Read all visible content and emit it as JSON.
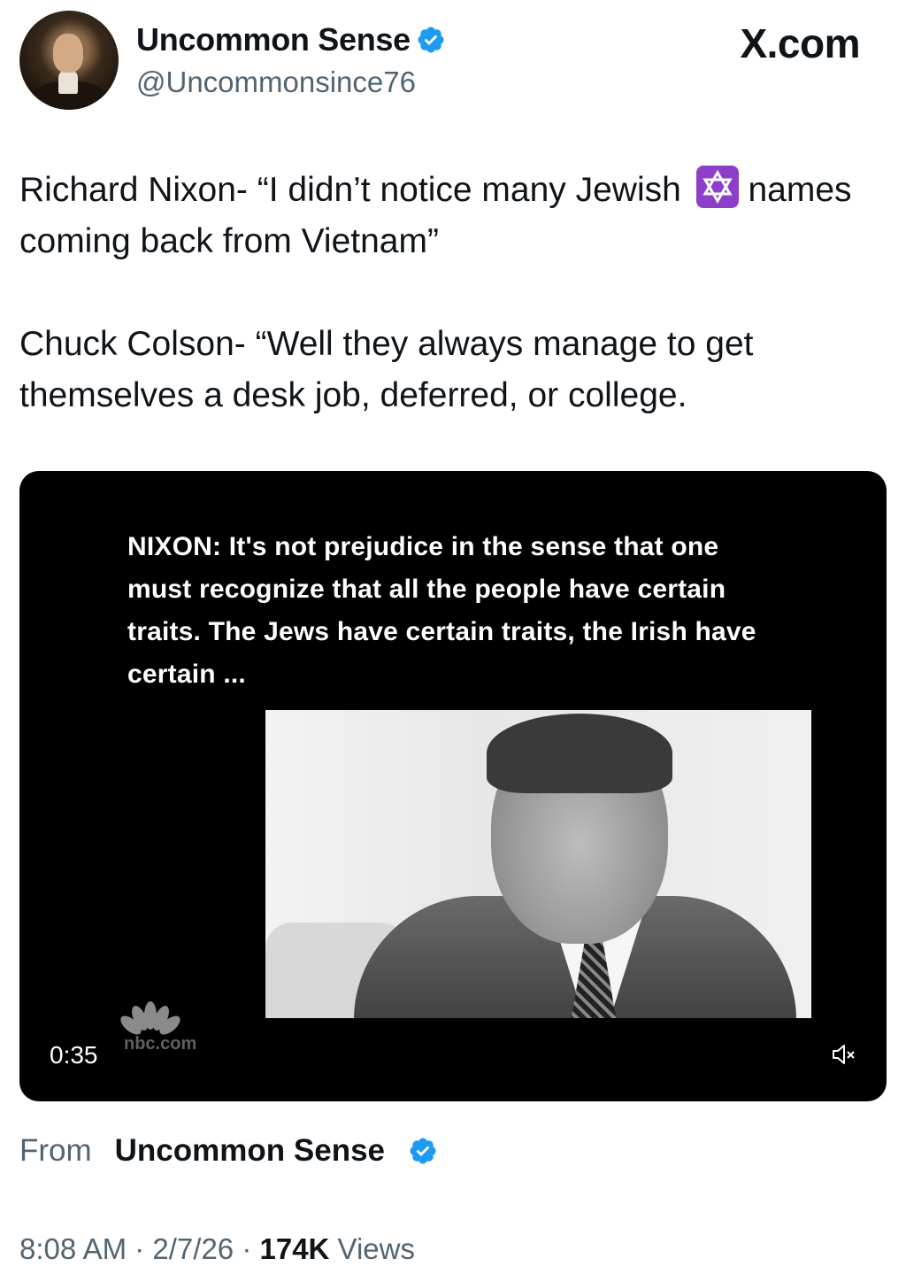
{
  "header": {
    "display_name": "Uncommon Sense",
    "handle": "@Uncommonsince76",
    "brand": "X.com",
    "verified_color": "#1d9bf0"
  },
  "tweet": {
    "paragraphs": [
      {
        "text": "Richard Nixon- “I didn’t notice many Jewish ",
        "emoji": "star-of-david",
        "after": " names coming back from Vietnam”"
      },
      {
        "text": "Chuck Colson- “Well they always manage to get themselves a desk job, deferred, or college."
      }
    ]
  },
  "video": {
    "caption": "NIXON: It's not prejudice in the sense that one must recognize that all the people have certain traits.  The Jews have certain traits, the Irish have certain ...",
    "watermark": "nbc.com",
    "duration": "0:35",
    "muted": true
  },
  "attribution": {
    "label": "From",
    "name": "Uncommon Sense"
  },
  "meta": {
    "time": "8:08 AM",
    "separator": " · ",
    "date": "2/7/26",
    "views_count": "174K",
    "views_label": "Views"
  }
}
